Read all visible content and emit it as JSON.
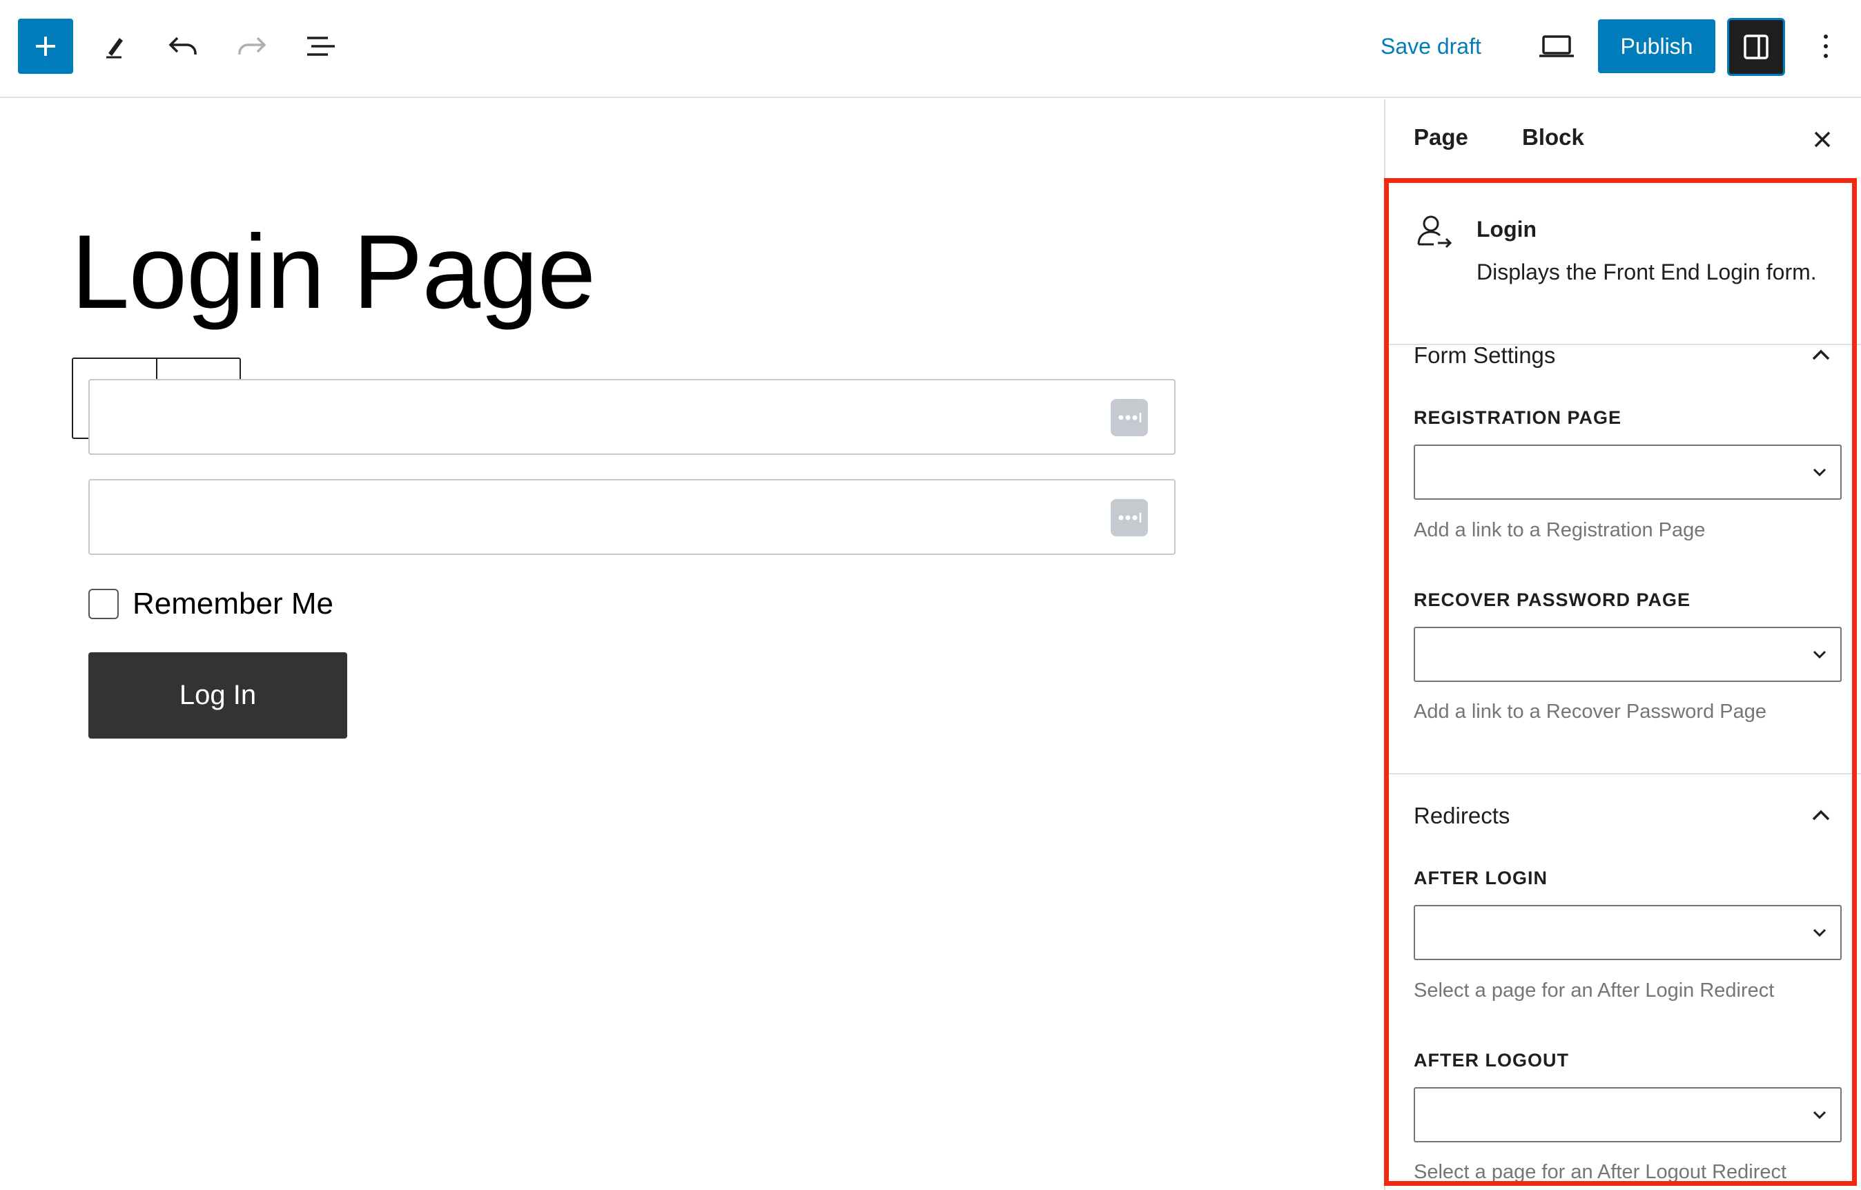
{
  "toolbar": {
    "save_draft": "Save draft",
    "publish": "Publish",
    "icons": [
      "plus-icon",
      "pencil-icon",
      "undo-icon",
      "redo-icon",
      "list-view-icon",
      "desktop-preview-icon",
      "sidebar-toggle-icon",
      "more-vertical-icon"
    ]
  },
  "editor": {
    "title": "Login Page",
    "remember_label": "Remember Me",
    "login_button": "Log In"
  },
  "sidebar": {
    "tabs": [
      "Page",
      "Block"
    ],
    "block": {
      "title": "Login",
      "description": "Displays the Front End Login form."
    },
    "form_settings": {
      "heading": "Form Settings",
      "registration_label": "Registration Page",
      "registration_help": "Add a link to a Registration Page",
      "recover_label": "Recover Password Page",
      "recover_help": "Add a link to a Recover Password Page"
    },
    "redirects": {
      "heading": "Redirects",
      "after_login_label": "After Login",
      "after_login_help": "Select a page for an After Login Redirect",
      "after_logout_label": "After Logout",
      "after_logout_help": "Select a page for an After Logout Redirect"
    }
  },
  "colors": {
    "accent": "#007cba",
    "highlight": "#f02a10",
    "login_button": "#333333"
  }
}
